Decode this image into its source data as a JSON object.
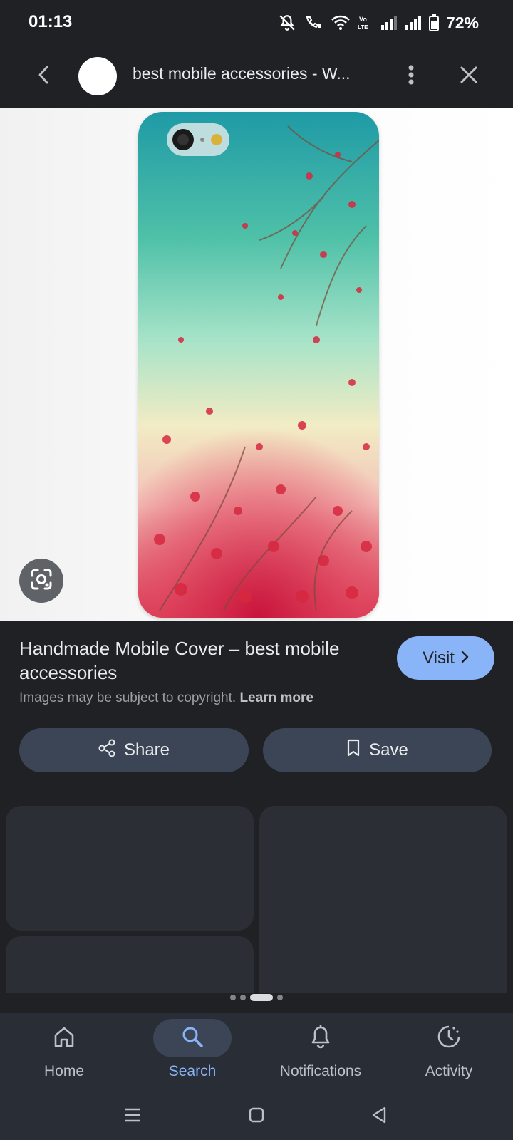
{
  "status_bar": {
    "time": "01:13",
    "battery": "72%",
    "icons": [
      "mute-icon",
      "wifi-call-icon",
      "wifi-icon",
      "volte-icon",
      "signal-icon",
      "signal-icon",
      "battery-icon"
    ]
  },
  "top_bar": {
    "title": "best mobile accessories - W...",
    "icons": [
      "back-arrow-icon",
      "more-vert-icon",
      "close-icon"
    ]
  },
  "image": {
    "subject": "phone case",
    "lens_icon": "google-lens-icon"
  },
  "result": {
    "title": "Handmade Mobile Cover – best mobile accessories",
    "visit_label": "Visit",
    "copyright_text": "Images may be subject to copyright.",
    "learn_more": "Learn more",
    "share_label": "Share",
    "save_label": "Save"
  },
  "bottom_nav": {
    "items": [
      {
        "label": "Home",
        "icon": "home-icon",
        "active": false
      },
      {
        "label": "Search",
        "icon": "search-icon",
        "active": true
      },
      {
        "label": "Notifications",
        "icon": "bell-icon",
        "active": false
      },
      {
        "label": "Activity",
        "icon": "activity-icon",
        "active": false
      }
    ]
  },
  "system_nav": {
    "icons": [
      "recents-icon",
      "home-button-icon",
      "back-triangle-icon"
    ]
  },
  "colors": {
    "background": "#202124",
    "accent": "#8ab4f8",
    "button": "#3c4555",
    "nav": "#292d35"
  }
}
